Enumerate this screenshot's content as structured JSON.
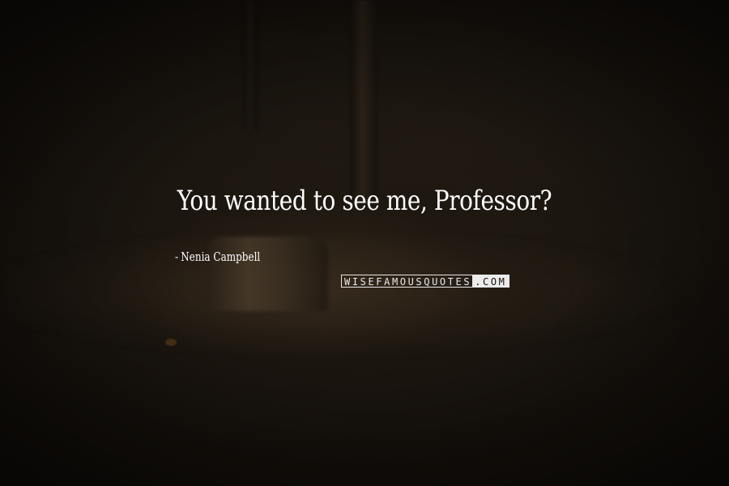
{
  "quote": {
    "text": "You wanted to see me, Professor?"
  },
  "author": {
    "dash": "-",
    "name": "Nenia Campbell"
  },
  "watermark": {
    "main": "WISEFAMOUSQUOTES",
    "tld": ".COM"
  },
  "colors": {
    "text": "#ffffff",
    "background": "#120f0b"
  }
}
